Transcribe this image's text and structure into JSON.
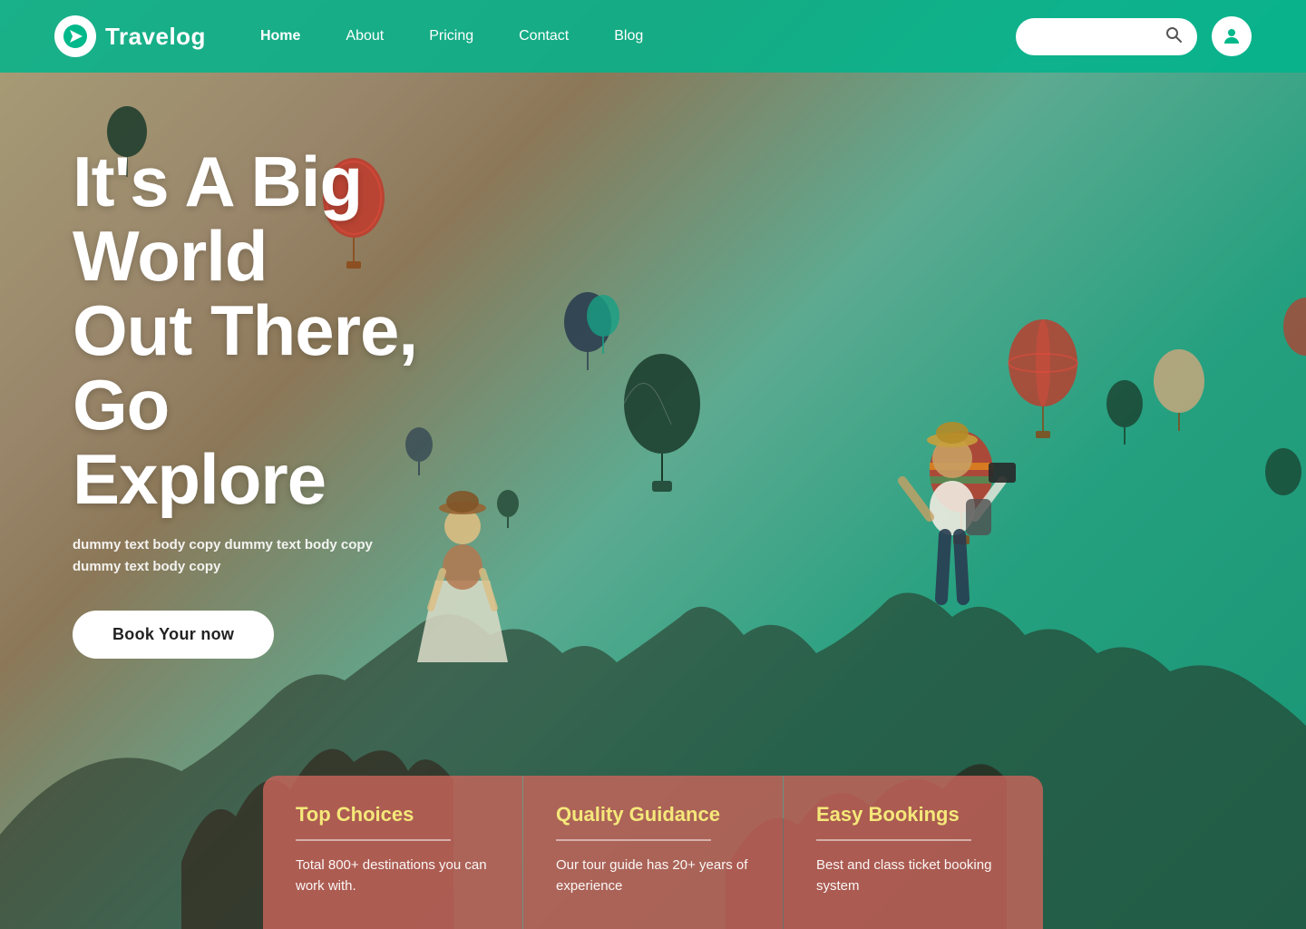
{
  "brand": {
    "name": "Travelog",
    "logo_alt": "Travelog logo"
  },
  "navbar": {
    "links": [
      {
        "label": "Home",
        "active": true
      },
      {
        "label": "About",
        "active": false
      },
      {
        "label": "Pricing",
        "active": false
      },
      {
        "label": "Contact",
        "active": false
      },
      {
        "label": "Blog",
        "active": false
      }
    ],
    "search_placeholder": ""
  },
  "hero": {
    "title_line1": "It's A Big World",
    "title_line2": "Out There, Go",
    "title_line3": "Explore",
    "subtitle": "dummy text body copy dummy text body copy  dummy text body copy",
    "cta_label": "Book Your now"
  },
  "cards": [
    {
      "title": "Top Choices",
      "divider": true,
      "text": "Total 800+ destinations you can work with."
    },
    {
      "title": "Quality Guidance",
      "divider": true,
      "text": "Our tour guide has 20+ years of experience"
    },
    {
      "title": "Easy Bookings",
      "divider": true,
      "text": "Best and class ticket booking system"
    }
  ]
}
